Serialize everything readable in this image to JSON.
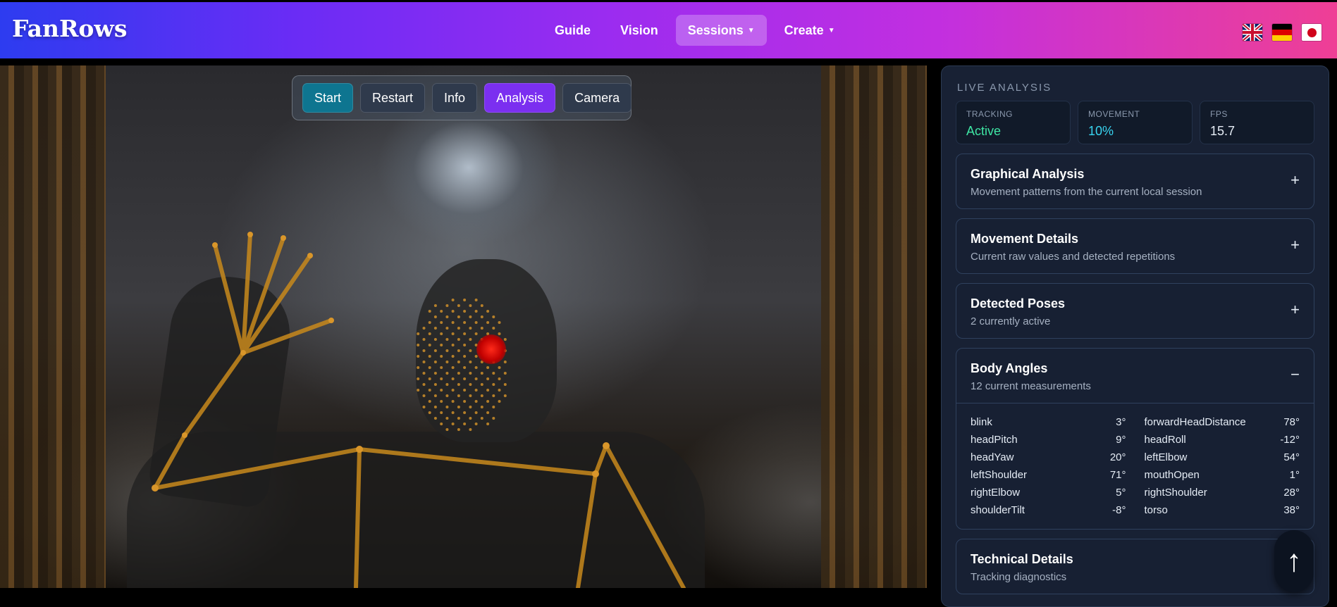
{
  "header": {
    "logo": "FanRows",
    "nav": [
      {
        "label": "Guide"
      },
      {
        "label": "Vision"
      },
      {
        "label": "Sessions",
        "dropdown": true,
        "active": true
      },
      {
        "label": "Create",
        "dropdown": true
      }
    ],
    "flags": [
      "uk-flag-icon",
      "germany-flag-icon",
      "japan-flag-icon"
    ]
  },
  "controls": {
    "start": "Start",
    "restart": "Restart",
    "info": "Info",
    "analysis": "Analysis",
    "camera": "Camera"
  },
  "panel": {
    "title": "LIVE ANALYSIS",
    "stats": {
      "tracking_label": "TRACKING",
      "tracking_value": "Active",
      "movement_label": "MOVEMENT",
      "movement_value": "10%",
      "fps_label": "FPS",
      "fps_value": "15.7"
    },
    "sections": {
      "graphical": {
        "title": "Graphical Analysis",
        "subtitle": "Movement patterns from the current local session",
        "toggle": "+"
      },
      "movement": {
        "title": "Movement Details",
        "subtitle": "Current raw values and detected repetitions",
        "toggle": "+"
      },
      "poses": {
        "title": "Detected Poses",
        "subtitle": "2 currently active",
        "toggle": "+"
      },
      "angles": {
        "title": "Body Angles",
        "subtitle": "12 current measurements",
        "toggle": "−"
      },
      "technical": {
        "title": "Technical Details",
        "subtitle": "Tracking diagnostics",
        "toggle": "+"
      }
    },
    "angles": [
      {
        "name": "blink",
        "value": "3°"
      },
      {
        "name": "forwardHeadDistance",
        "value": "78°"
      },
      {
        "name": "headPitch",
        "value": "9°"
      },
      {
        "name": "headRoll",
        "value": "-12°"
      },
      {
        "name": "headYaw",
        "value": "20°"
      },
      {
        "name": "leftElbow",
        "value": "54°"
      },
      {
        "name": "leftShoulder",
        "value": "71°"
      },
      {
        "name": "mouthOpen",
        "value": "1°"
      },
      {
        "name": "rightElbow",
        "value": "5°"
      },
      {
        "name": "rightShoulder",
        "value": "28°"
      },
      {
        "name": "shoulderTilt",
        "value": "-8°"
      },
      {
        "name": "torso",
        "value": "38°"
      }
    ]
  },
  "scroll_top": "↑",
  "colors": {
    "accent_purple": "#7b2ff0",
    "accent_teal": "#0e7590",
    "status_green": "#3ee6a4",
    "status_cyan": "#38d4f0",
    "skeleton_orange": "#c8891c"
  }
}
